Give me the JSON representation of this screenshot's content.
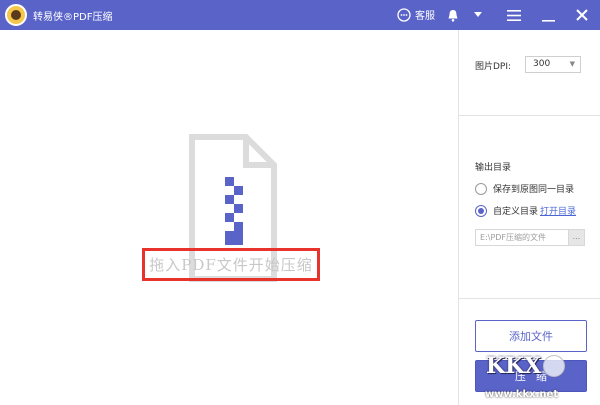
{
  "titlebar": {
    "app_title": "转易侠®PDF压缩",
    "service_label": "客服"
  },
  "drop_area": {
    "label": "拖入PDF文件开始压缩",
    "highlight_color": "#e8322c"
  },
  "settings": {
    "dpi_label": "图片DPI:",
    "dpi_value": "300",
    "output_title": "输出目录",
    "radio_same_dir": "保存到原图同一目录",
    "radio_custom_dir": "自定义目录",
    "open_dir_link": "打开目录",
    "selected_option": "custom",
    "path_placeholder": "E:\\PDF压缩的文件",
    "path_button": "..."
  },
  "actions": {
    "add_file": "添加文件",
    "compress": "压缩"
  },
  "watermark": {
    "logo_text": "KKX",
    "url": "www.kkx.net"
  },
  "colors": {
    "accent": "#5a64c8",
    "file_icon_gray": "#dcdcdc",
    "zipper": "#5a64c8"
  }
}
